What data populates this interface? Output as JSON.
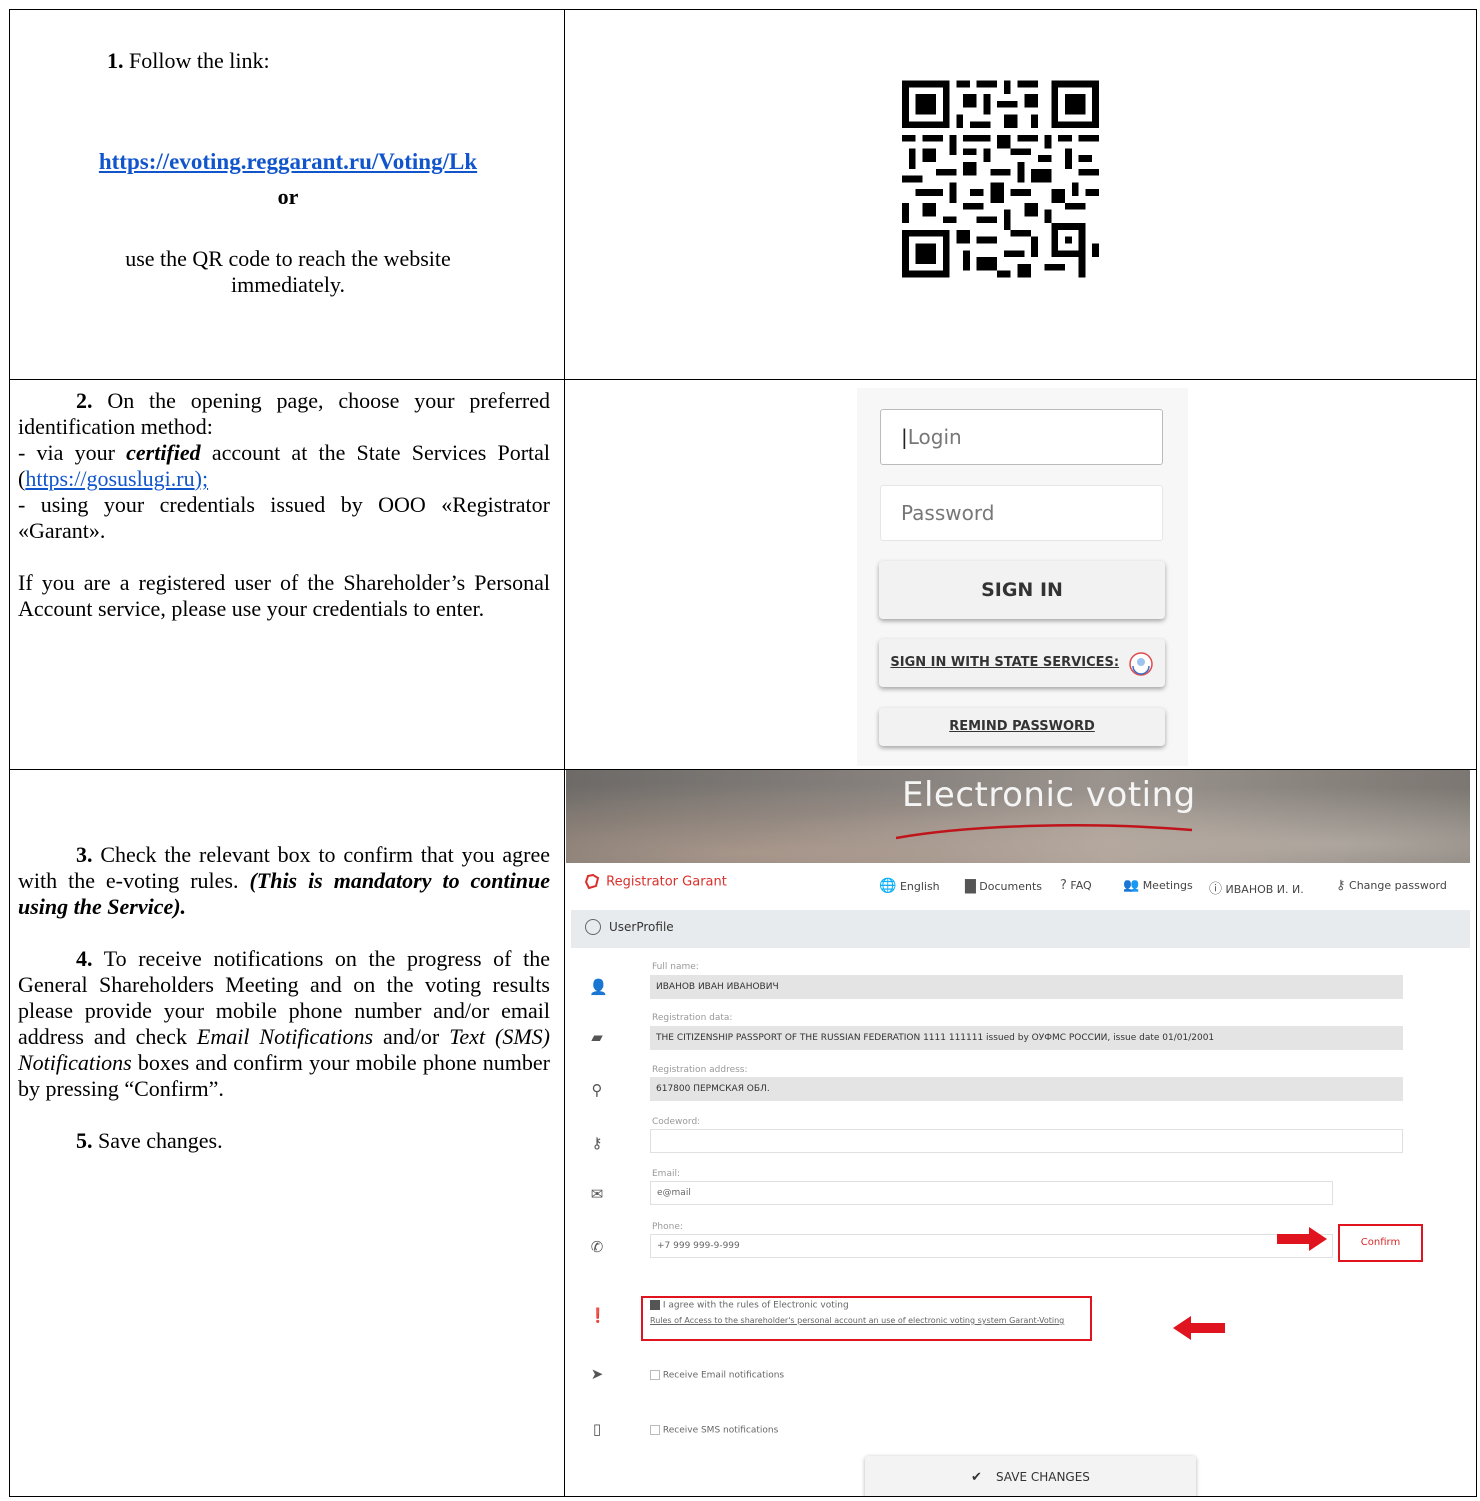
{
  "step1": {
    "num": "1.",
    "text": "Follow the link:",
    "link": "https://evoting.reggarant.ru/Voting/Lk",
    "or": "or",
    "qr_line1": "use the QR code to reach the website",
    "qr_line2": "immediately."
  },
  "step2": {
    "num": "2.",
    "intro": "On the opening page, choose your preferred identification method:",
    "opt1_pre": "- via your ",
    "opt1_em": "certified",
    "opt1_post": " account at the State Services Portal (",
    "opt1_link": "https://gosuslugi.ru",
    "opt1_end": ");",
    "opt2": "- using your credentials issued by OOO «Registrator «Garant».",
    "note": "If you are a registered user of the Shareholder’s Personal Account service, please use your credentials to enter."
  },
  "login": {
    "login_placeholder": "Login",
    "password_placeholder": "Password",
    "sign_in": "SIGN IN",
    "state_services": "SIGN IN WITH STATE SERVICES:",
    "remind": "REMIND PASSWORD"
  },
  "step3": {
    "num3": "3.",
    "text3": "Check the relevant box to confirm that you agree with the e-voting rules.",
    "text3_em": "(This is mandatory to continue using the Service).",
    "num4": "4.",
    "text4_a": "To receive notifications on the progress of the General Shareholders Meeting and on the voting results please provide your mobile phone number and/or email address and check ",
    "text4_em1": "Email Notifications",
    "text4_b": " and/or ",
    "text4_em2": "Text (SMS) Notifications",
    "text4_c": " boxes and confirm your mobile phone number by pressing “Confirm”.",
    "num5": "5.",
    "text5": "Save changes."
  },
  "profile": {
    "banner": "Electronic voting",
    "brand": "Registrator Garant",
    "nav": [
      "English",
      "Documents",
      "FAQ",
      "Meetings",
      "ИВАНОВ И. И.",
      "Change password"
    ],
    "section": "UserProfile",
    "full_name_label": "Full name:",
    "full_name": "ИВАНОВ ИВАН ИВАНОВИЧ",
    "reg_data_label": "Registration data:",
    "reg_data": "THE CITIZENSHIP PASSPORT OF THE RUSSIAN FEDERATION 1111 111111 issued by ОУФМС РОССИИ, issue date 01/01/2001",
    "reg_addr_label": "Registration address:",
    "reg_addr": "617800 ПЕРМСКАЯ ОБЛ.",
    "codeword_label": "Codeword:",
    "email_label": "Email:",
    "email": "e@mail",
    "phone_label": "Phone:",
    "phone": "+7 999 999-9-999",
    "confirm": "Confirm",
    "agree": "I agree with the rules of Electronic voting",
    "rules_link": "Rules of Access to the shareholder's personal account an use of electronic voting system Garant-Voting",
    "email_notif": "Receive Email notifications",
    "sms_notif": "Receive SMS notifications",
    "save": "SAVE CHANGES"
  },
  "colors": {
    "link": "#1155cc",
    "accent_red": "#e0141e",
    "brand_red": "#d9302b"
  }
}
